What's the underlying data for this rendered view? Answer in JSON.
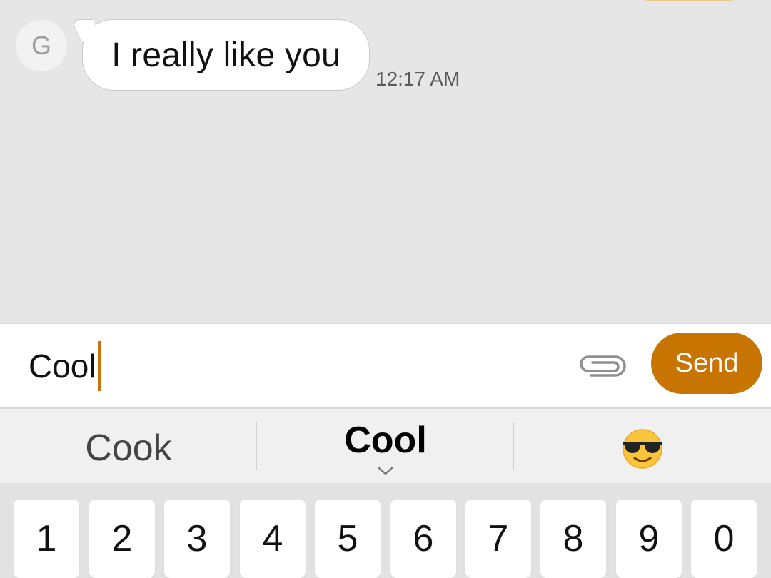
{
  "conversation": {
    "contact_initial": "G",
    "messages": [
      {
        "text": "I really like you",
        "time": "12:17 AM"
      }
    ]
  },
  "compose": {
    "value": "Cool",
    "send_label": "Send",
    "attach_icon": "paperclip-icon"
  },
  "suggestions": {
    "items": [
      "Cook",
      "Cool"
    ],
    "emoji_icon": "sunglasses-emoji"
  },
  "keyboard": {
    "number_row": [
      "1",
      "2",
      "3",
      "4",
      "5",
      "6",
      "7",
      "8",
      "9",
      "0"
    ]
  },
  "colors": {
    "accent": "#c87401",
    "background": "#e6e6e6"
  }
}
